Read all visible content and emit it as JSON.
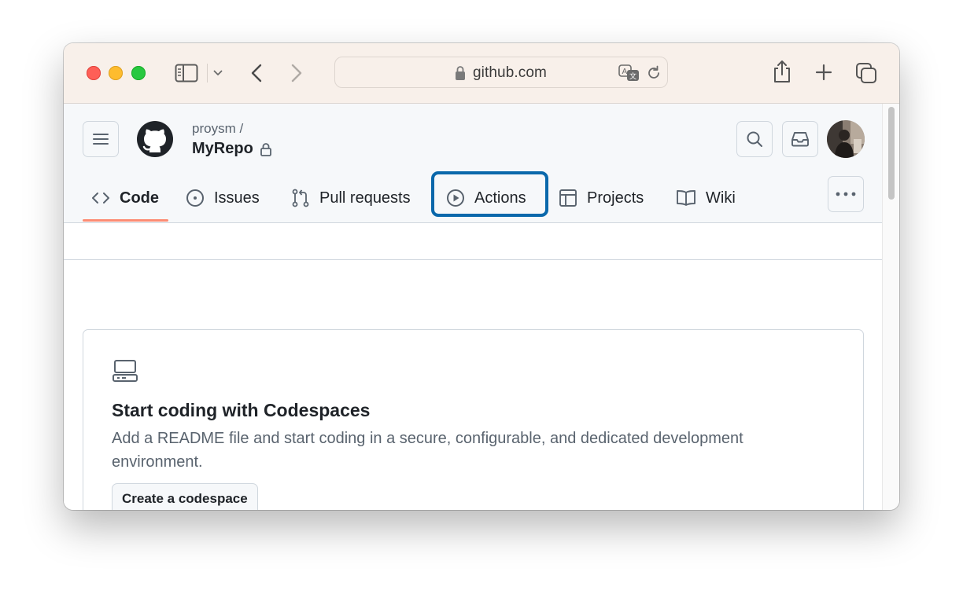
{
  "browser": {
    "url": "github.com",
    "buttons": [
      "sidebar-toggle",
      "back",
      "forward",
      "translate",
      "reload",
      "share",
      "new-tab",
      "tab-overview"
    ]
  },
  "repo": {
    "owner": "proysm /",
    "name": "MyRepo"
  },
  "nav": {
    "tabs": [
      {
        "label": "Code",
        "icon": "code-icon",
        "active": true
      },
      {
        "label": "Issues",
        "icon": "issue-icon",
        "active": false
      },
      {
        "label": "Pull requests",
        "icon": "pull-request-icon",
        "active": false
      },
      {
        "label": "Actions",
        "icon": "play-icon",
        "active": false,
        "highlighted": true
      },
      {
        "label": "Projects",
        "icon": "table-icon",
        "active": false
      },
      {
        "label": "Wiki",
        "icon": "book-icon",
        "active": false
      }
    ]
  },
  "codespaces_card": {
    "title": "Start coding with Codespaces",
    "description": "Add a README file and start coding in a secure, configurable, and dedicated development environment.",
    "button_label": "Create a codespace"
  },
  "colors": {
    "active_tab_underline": "#fd8c73",
    "highlight_border": "#0a68ab",
    "header_bg": "#f6f8fa",
    "toolbar_bg": "#f8f0ea"
  }
}
